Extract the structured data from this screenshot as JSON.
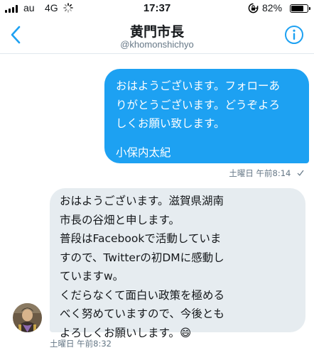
{
  "status_bar": {
    "carrier": "au",
    "network": "4G",
    "time": "17:37",
    "battery": "82%",
    "battery_level": 0.82
  },
  "header": {
    "title": "黄門市長",
    "handle": "@khomonshichyo"
  },
  "messages": [
    {
      "direction": "outgoing",
      "lines": [
        "おはようございます。フォローあ",
        "りがとうございます。どうぞよろ",
        "しくお願い致します。"
      ],
      "signature": "小保内太紀",
      "day": "土曜日",
      "time": "午前8:14",
      "status_icon": "sent-check-icon"
    },
    {
      "direction": "incoming",
      "lines": [
        "おはようございます。滋賀県湖南",
        "市長の谷畑と申します。",
        "普段はFacebookで活動していま",
        "すので、Twitterの初DMに感動し",
        "ていますw。",
        "くだらなくて面白い政策を極める",
        "べく努めていますので、今後とも",
        "よろしくお願いします。"
      ],
      "emoji": "😄",
      "day": "土曜日",
      "time": "午前8:32"
    }
  ],
  "colors": {
    "accent": "#1da1f2",
    "incoming_bubble": "#e6ecf0",
    "secondary_text": "#657786"
  }
}
